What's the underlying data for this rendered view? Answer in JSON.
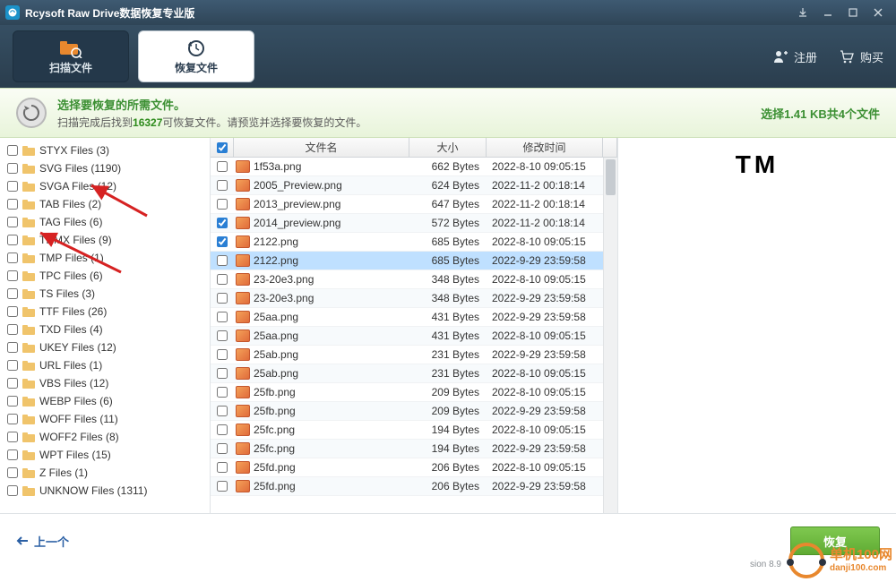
{
  "titlebar": {
    "title": "Rcysoft Raw Drive数据恢复专业版"
  },
  "toolbar": {
    "scan_tab": "扫描文件",
    "recover_tab": "恢复文件",
    "register": "注册",
    "buy": "购买"
  },
  "info": {
    "line1": "选择要恢复的所需文件。",
    "line2_prefix": "扫描完成后找到",
    "found_count": "16327",
    "line2_suffix": "可恢复文件。请预览并选择要恢复的文件。",
    "summary": "选择1.41 KB共4个文件"
  },
  "left_items": [
    "STYX Files (3)",
    "SVG Files (1190)",
    "SVGA Files (12)",
    "TAB Files (2)",
    "TAG Files (6)",
    "THMX Files (9)",
    "TMP Files (1)",
    "TPC Files (6)",
    "TS Files (3)",
    "TTF Files (26)",
    "TXD Files (4)",
    "UKEY Files (12)",
    "URL Files (1)",
    "VBS Files (12)",
    "WEBP Files (6)",
    "WOFF Files (11)",
    "WOFF2 Files (8)",
    "WPT Files (15)",
    "Z Files (1)",
    "UNKNOW Files (1311)"
  ],
  "table": {
    "header": {
      "name": "文件名",
      "size": "大小",
      "time": "修改时间"
    },
    "rows": [
      {
        "chk": false,
        "name": "1f53a.png",
        "size": "662 Bytes",
        "time": "2022-8-10 09:05:15",
        "sel": false
      },
      {
        "chk": false,
        "name": "2005_Preview.png",
        "size": "624 Bytes",
        "time": "2022-11-2 00:18:14",
        "sel": false
      },
      {
        "chk": false,
        "name": "2013_preview.png",
        "size": "647 Bytes",
        "time": "2022-11-2 00:18:14",
        "sel": false
      },
      {
        "chk": true,
        "name": "2014_preview.png",
        "size": "572 Bytes",
        "time": "2022-11-2 00:18:14",
        "sel": false
      },
      {
        "chk": true,
        "name": "2122.png",
        "size": "685 Bytes",
        "time": "2022-8-10 09:05:15",
        "sel": false
      },
      {
        "chk": false,
        "name": "2122.png",
        "size": "685 Bytes",
        "time": "2022-9-29 23:59:58",
        "sel": true
      },
      {
        "chk": false,
        "name": "23-20e3.png",
        "size": "348 Bytes",
        "time": "2022-8-10 09:05:15",
        "sel": false
      },
      {
        "chk": false,
        "name": "23-20e3.png",
        "size": "348 Bytes",
        "time": "2022-9-29 23:59:58",
        "sel": false
      },
      {
        "chk": false,
        "name": "25aa.png",
        "size": "431 Bytes",
        "time": "2022-9-29 23:59:58",
        "sel": false
      },
      {
        "chk": false,
        "name": "25aa.png",
        "size": "431 Bytes",
        "time": "2022-8-10 09:05:15",
        "sel": false
      },
      {
        "chk": false,
        "name": "25ab.png",
        "size": "231 Bytes",
        "time": "2022-9-29 23:59:58",
        "sel": false
      },
      {
        "chk": false,
        "name": "25ab.png",
        "size": "231 Bytes",
        "time": "2022-8-10 09:05:15",
        "sel": false
      },
      {
        "chk": false,
        "name": "25fb.png",
        "size": "209 Bytes",
        "time": "2022-8-10 09:05:15",
        "sel": false
      },
      {
        "chk": false,
        "name": "25fb.png",
        "size": "209 Bytes",
        "time": "2022-9-29 23:59:58",
        "sel": false
      },
      {
        "chk": false,
        "name": "25fc.png",
        "size": "194 Bytes",
        "time": "2022-8-10 09:05:15",
        "sel": false
      },
      {
        "chk": false,
        "name": "25fc.png",
        "size": "194 Bytes",
        "time": "2022-9-29 23:59:58",
        "sel": false
      },
      {
        "chk": false,
        "name": "25fd.png",
        "size": "206 Bytes",
        "time": "2022-8-10 09:05:15",
        "sel": false
      },
      {
        "chk": false,
        "name": "25fd.png",
        "size": "206 Bytes",
        "time": "2022-9-29 23:59:58",
        "sel": false
      }
    ]
  },
  "preview": {
    "text": "TM"
  },
  "footer": {
    "back": "上一个",
    "recover": "恢复"
  },
  "watermark": {
    "name": "单机100网",
    "url": "danji100.com"
  },
  "version": "sion 8.9"
}
